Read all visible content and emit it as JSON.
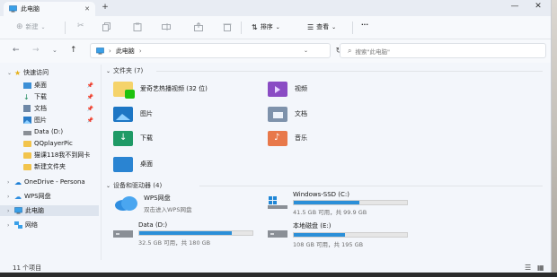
{
  "window": {
    "tab_title": "此电脑",
    "new_tab": "+",
    "minimize": "—",
    "close": "✕"
  },
  "commandbar": {
    "new_label": "新建",
    "sort_label": "排序",
    "view_label": "查看",
    "more": "···"
  },
  "address": {
    "path": "此电脑",
    "separator": "›",
    "search_placeholder": "搜索\"此电脑\""
  },
  "sidebar": {
    "quick_access": "快速访问",
    "items": [
      {
        "label": "桌面",
        "pinned": true
      },
      {
        "label": "下载",
        "pinned": true
      },
      {
        "label": "文档",
        "pinned": true
      },
      {
        "label": "图片",
        "pinned": true
      },
      {
        "label": "Data (D:)",
        "pinned": false
      },
      {
        "label": "QQplayerPic",
        "pinned": false
      },
      {
        "label": "猫课118我不到网卡",
        "pinned": false
      },
      {
        "label": "新建文件夹",
        "pinned": false
      }
    ],
    "onedrive": "OneDrive - Persona",
    "wps": "WPS网盘",
    "this_pc": "此电脑",
    "network": "网络"
  },
  "folders_group": {
    "header": "文件夹 (7)",
    "items": [
      {
        "label": "爱奇艺热播视频 (32 位)",
        "icon": "iqiyi-folder-icon"
      },
      {
        "label": "视频",
        "icon": "videos-folder-icon"
      },
      {
        "label": "图片",
        "icon": "pictures-folder-icon"
      },
      {
        "label": "文档",
        "icon": "documents-folder-icon"
      },
      {
        "label": "下载",
        "icon": "downloads-folder-icon"
      },
      {
        "label": "音乐",
        "icon": "music-folder-icon"
      },
      {
        "label": "桌面",
        "icon": "desktop-folder-icon"
      }
    ]
  },
  "drives_group": {
    "header": "设备和驱动器 (4)",
    "wps": {
      "name": "WPS网盘",
      "sub": "双击进入WPS网盘"
    },
    "drives": [
      {
        "name": "Windows-SSD (C:)",
        "free": "41.5 GB 可用，共 99.9 GB",
        "used_fraction": 0.58
      },
      {
        "name": "Data (D:)",
        "free": "32.5 GB 可用，共 180 GB",
        "used_fraction": 0.82
      },
      {
        "name": "本地磁盘 (E:)",
        "free": "108 GB 可用，共 195 GB",
        "used_fraction": 0.45
      }
    ]
  },
  "status": {
    "count": "11 个项目"
  },
  "colors": {
    "accent": "#2b8fd8",
    "folder": "#f2c44c"
  }
}
